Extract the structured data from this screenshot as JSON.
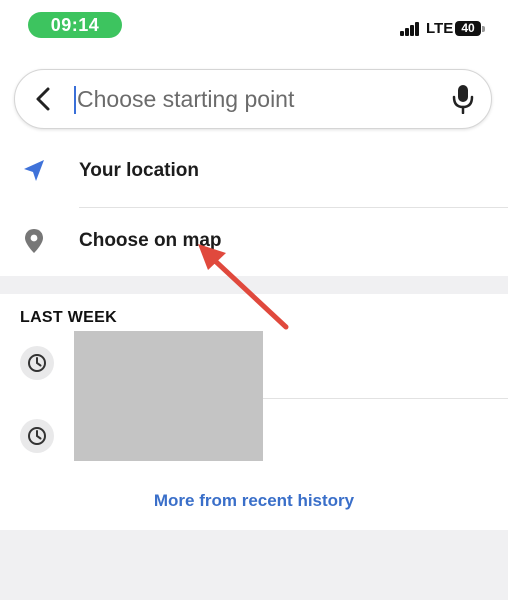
{
  "status_bar": {
    "time": "09:14",
    "network": "LTE",
    "battery": "40"
  },
  "search": {
    "placeholder": "Choose starting point",
    "value": ""
  },
  "options": [
    {
      "label": "Your location",
      "icon": "navigation-arrow-icon"
    },
    {
      "label": "Choose on map",
      "icon": "map-pin-icon"
    }
  ],
  "history": {
    "section_title": "LAST WEEK",
    "more_label": "More from recent history"
  },
  "colors": {
    "accent": "#3a6fc9",
    "time_pill": "#3dc45f",
    "annotation_arrow": "#e0493d"
  }
}
